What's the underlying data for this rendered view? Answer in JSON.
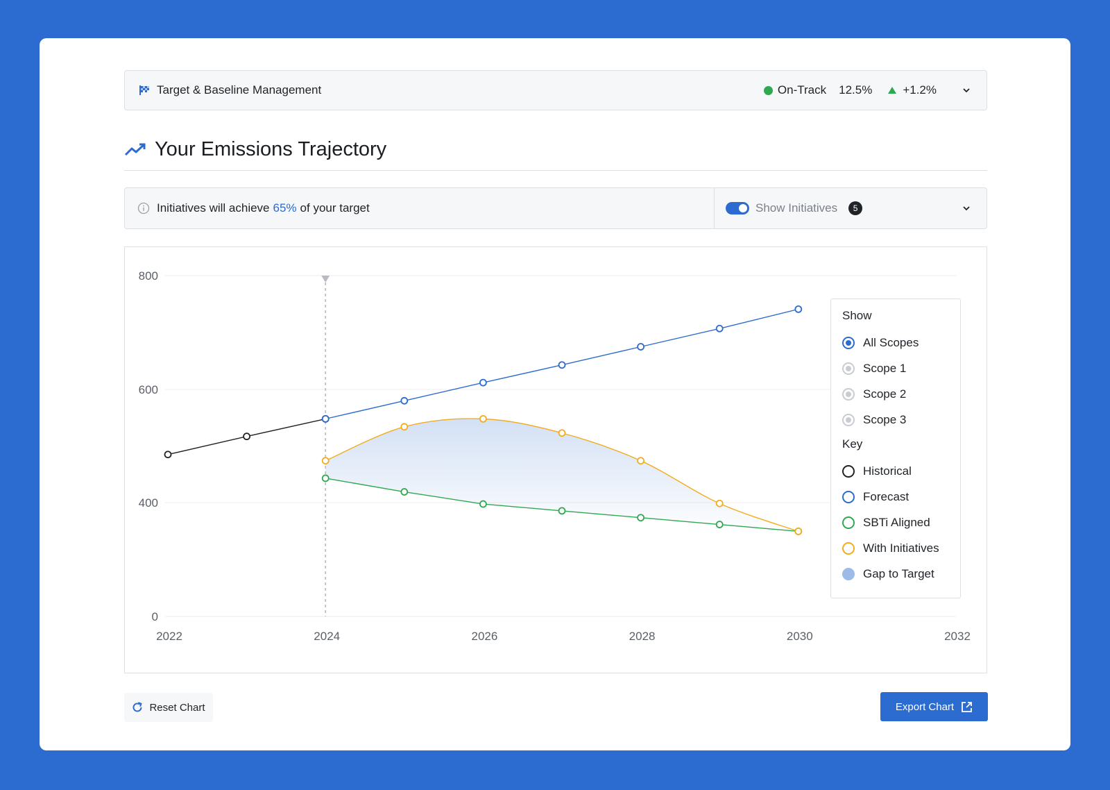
{
  "header": {
    "title": "Target & Baseline Management",
    "status": "On-Track",
    "percent": "12.5%",
    "change": "+1.2%",
    "status_color": "#2fa84f"
  },
  "section": {
    "title": "Your Emissions Trajectory"
  },
  "info": {
    "prefix": "Initiatives will achieve",
    "highlight": "65%",
    "suffix": "of your target",
    "toggle_label": "Show Initiatives",
    "toggle_on": true,
    "badge_count": "5"
  },
  "legend": {
    "show_heading": "Show",
    "scopes": [
      {
        "label": "All Scopes",
        "selected": true
      },
      {
        "label": "Scope 1",
        "selected": false
      },
      {
        "label": "Scope 2",
        "selected": false
      },
      {
        "label": "Scope 3",
        "selected": false
      }
    ],
    "key_heading": "Key",
    "keys": [
      {
        "label": "Historical",
        "color": "#222222",
        "style": "ring"
      },
      {
        "label": "Forecast",
        "color": "#2c6bcf",
        "style": "ring"
      },
      {
        "label": "SBTi Aligned",
        "color": "#2fa84f",
        "style": "ring"
      },
      {
        "label": "With Initiatives",
        "color": "#f2ac1c",
        "style": "ring"
      },
      {
        "label": "Gap to Target",
        "color": "#9dbbe8",
        "style": "fill"
      }
    ]
  },
  "buttons": {
    "reset_label": "Reset Chart",
    "export_label": "Export Chart",
    "accent": "#2c6bcf"
  },
  "chart_data": {
    "type": "line",
    "xlim": [
      2022,
      2032
    ],
    "ylim": [
      0,
      800
    ],
    "x_ticks": [
      2022,
      2024,
      2026,
      2028,
      2030,
      2032
    ],
    "y_ticks": [
      0,
      400,
      600,
      800
    ],
    "marker_year": 2024,
    "grid": true,
    "legend_position": "right",
    "series": [
      {
        "name": "Historical",
        "color": "#222222",
        "x": [
          2022,
          2023,
          2024
        ],
        "y": [
          485,
          517,
          548
        ]
      },
      {
        "name": "Forecast",
        "color": "#2c6bcf",
        "x": [
          2024,
          2025,
          2026,
          2027,
          2028,
          2029,
          2030
        ],
        "y": [
          548,
          580,
          612,
          643,
          675,
          707,
          741
        ]
      },
      {
        "name": "SBTi Aligned",
        "color": "#2fa84f",
        "x": [
          2024,
          2025,
          2026,
          2027,
          2028,
          2029,
          2030
        ],
        "y": [
          443,
          419,
          395,
          371,
          347,
          323,
          299
        ]
      },
      {
        "name": "With Initiatives",
        "color": "#f2ac1c",
        "x": [
          2024,
          2025,
          2026,
          2027,
          2028,
          2029,
          2030
        ],
        "y": [
          474,
          534,
          548,
          523,
          474,
          397,
          299
        ]
      }
    ],
    "fill_between": {
      "name": "Gap to Target",
      "upper": "With Initiatives",
      "lower": "SBTi Aligned",
      "color": "#9dbbe8"
    }
  }
}
